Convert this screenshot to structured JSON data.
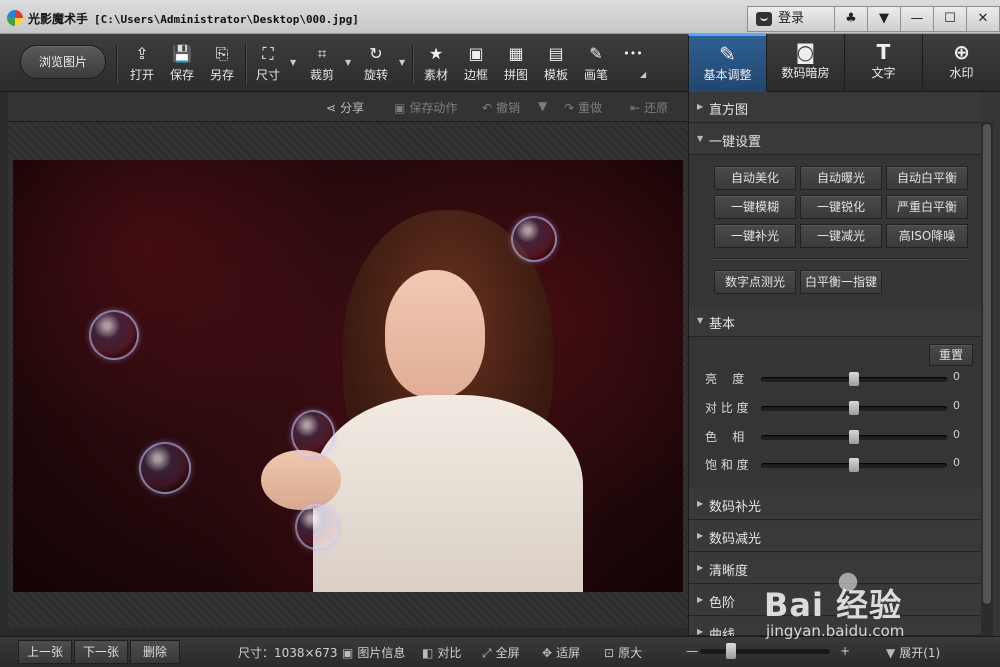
{
  "window": {
    "app_name": "光影魔术手",
    "path": "[C:\\Users\\Administrator\\Desktop\\000.jpg]",
    "login_label": "登录",
    "icons": [
      "pin-icon",
      "dropdown-icon",
      "minimize-icon",
      "maximize-icon",
      "close-icon"
    ],
    "glyphs": {
      "pin": "♣",
      "dropdown": "▼",
      "minimize": "—",
      "maximize": "☐",
      "close": "✕"
    }
  },
  "toolbar": {
    "browse_label": "浏览图片",
    "tools": [
      {
        "label": "打开",
        "glyph": "⇪"
      },
      {
        "label": "保存",
        "glyph": "💾"
      },
      {
        "label": "另存",
        "glyph": "⎘"
      },
      {
        "label": "尺寸",
        "glyph": "⛶"
      },
      {
        "label": "裁剪",
        "glyph": "⌗"
      },
      {
        "label": "旋转",
        "glyph": "↻"
      },
      {
        "label": "素材",
        "glyph": "★"
      },
      {
        "label": "边框",
        "glyph": "▣"
      },
      {
        "label": "拼图",
        "glyph": "▦"
      },
      {
        "label": "模板",
        "glyph": "▤"
      },
      {
        "label": "画笔",
        "glyph": "✎"
      },
      {
        "label": "",
        "glyph": "•••"
      }
    ],
    "tabs": [
      {
        "label": "基本调整",
        "glyph": "✎",
        "active": true
      },
      {
        "label": "数码暗房",
        "glyph": "◙",
        "active": false
      },
      {
        "label": "文字",
        "glyph": "T",
        "active": false
      },
      {
        "label": "水印",
        "glyph": "⊕",
        "active": false
      }
    ]
  },
  "subbar": {
    "share": "分享",
    "save_action": "保存动作",
    "undo": "撤销",
    "redo": "重做",
    "restore": "还原"
  },
  "panel": {
    "histogram": "直方图",
    "one_click": "一键设置",
    "buttons_row1": [
      "自动美化",
      "自动曝光",
      "自动白平衡"
    ],
    "buttons_row2": [
      "一键模糊",
      "一键锐化",
      "严重白平衡"
    ],
    "buttons_row3": [
      "一键补光",
      "一键减光",
      "高ISO降噪"
    ],
    "buttons_row4": [
      "数字点测光",
      "白平衡一指键"
    ],
    "basic": "基本",
    "reset": "重置",
    "sliders": [
      {
        "label": "亮    度",
        "value": 0,
        "level": 0.5
      },
      {
        "label": "对 比 度",
        "value": 0,
        "level": 0.5
      },
      {
        "label": "色    相",
        "value": 0,
        "level": 0.5
      },
      {
        "label": "饱 和 度",
        "value": 0,
        "level": 0.5
      }
    ],
    "sections": [
      "数码补光",
      "数码减光",
      "清晰度",
      "色阶",
      "曲线"
    ]
  },
  "status": {
    "prev": "上一张",
    "next": "下一张",
    "delete": "删除",
    "size": "尺寸：1038×673",
    "info": "图片信息",
    "compare": "对比",
    "fullscreen": "全屏",
    "fit": "适屏",
    "original": "原大",
    "zoom_minus": "—",
    "zoom_plus": "+",
    "zoom_level": 0.22,
    "expand": "展开(1)"
  },
  "watermark": {
    "brand": "Bai 经验",
    "site": "jingyan.baidu.com"
  },
  "colors": {
    "active_tab": "#2e5f92",
    "panel_bg": "#353535",
    "canvas_bg": "#2e2e2e"
  }
}
